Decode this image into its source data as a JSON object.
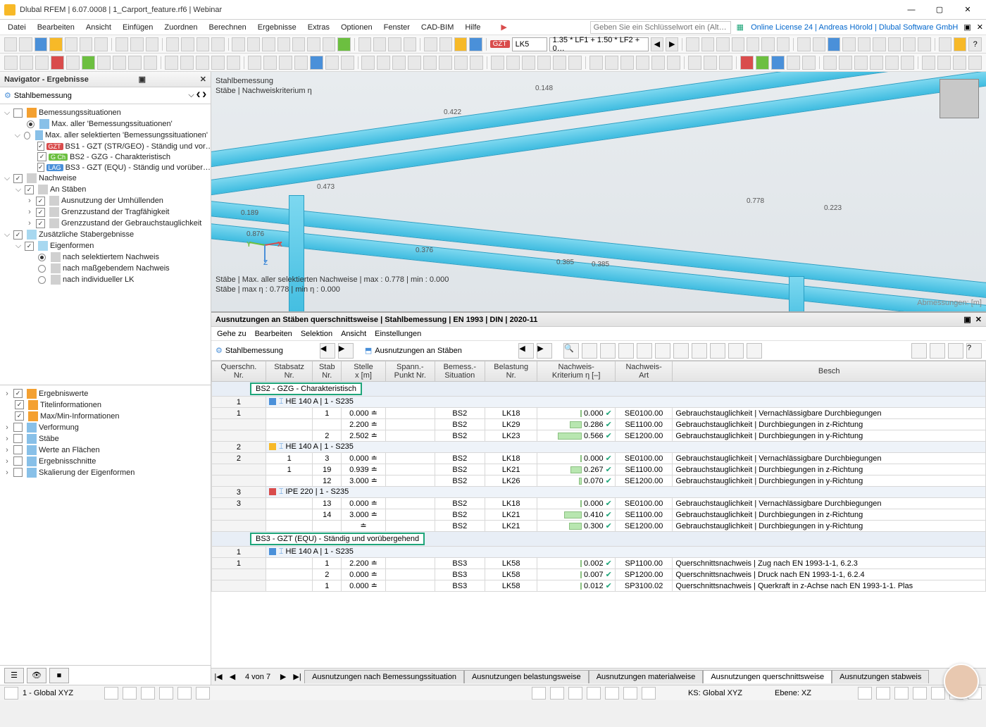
{
  "title": "Dlubal RFEM | 6.07.0008 | 1_Carport_feature.rf6 | Webinar",
  "menu": [
    "Datei",
    "Bearbeiten",
    "Ansicht",
    "Einfügen",
    "Zuordnen",
    "Berechnen",
    "Ergebnisse",
    "Extras",
    "Optionen",
    "Fenster",
    "CAD-BIM",
    "Hilfe"
  ],
  "search_placeholder": "Geben Sie ein Schlüsselwort ein (Alt…",
  "license": "Online License 24 | Andreas Hörold | Dlubal Software GmbH",
  "lc_badge": "GZT",
  "lc_combo": "LK5",
  "lc_formula": "1.35 * LF1 + 1.50 * LF2 + 0…",
  "nav": {
    "header": "Navigator - Ergebnisse",
    "selector": "Stahlbemessung",
    "tree": {
      "bs": "Bemessungssituationen",
      "bs_max_all": "Max. aller 'Bemessungssituationen'",
      "bs_max_sel": "Max. aller selektierten 'Bemessungssituationen'",
      "bs1": "BS1 - GZT (STR/GEO) - Ständig und vor…",
      "bs2": "BS2 - GZG - Charakteristisch",
      "bs3": "BS3 - GZT (EQU) - Ständig und vorüber…",
      "nachw": "Nachweise",
      "an_st": "An Stäben",
      "aus_umh": "Ausnutzung der Umhüllenden",
      "grenz_trag": "Grenzzustand der Tragfähigkeit",
      "grenz_gebr": "Grenzzustand der Gebrauchstauglichkeit",
      "zus": "Zusätzliche Stabergebnisse",
      "eigen": "Eigenformen",
      "e_sel": "nach selektiertem Nachweis",
      "e_mass": "nach maßgebendem Nachweis",
      "e_ind": "nach individueller LK"
    },
    "bottom": {
      "erg": "Ergebniswerte",
      "titel": "Titelinformationen",
      "maxmin": "Max/Min-Informationen",
      "verf": "Verformung",
      "staebe": "Stäbe",
      "flae": "Werte an Flächen",
      "ergsch": "Ergebnisschnitte",
      "skal": "Skalierung der Eigenformen"
    }
  },
  "viewport": {
    "title1": "Stahlbemessung",
    "title2": "Stäbe | Nachweiskriterium η",
    "status1": "Stäbe | Max. aller selektierten Nachweise | max  : 0.778 | min  : 0.000",
    "status2": "Stäbe | max η : 0.778 | min η : 0.000",
    "dim": "Abmessungen: [m]",
    "values": [
      "0.148",
      "0.422",
      "0.473",
      "0.189",
      "0.876",
      "0.376",
      "0.385",
      "0.385",
      "0.778",
      "0.223"
    ]
  },
  "panel": {
    "title": "Ausnutzungen an Stäben querschnittsweise | Stahlbemessung | EN 1993 | DIN | 2020-11",
    "menu": [
      "Gehe zu",
      "Bearbeiten",
      "Selektion",
      "Ansicht",
      "Einstellungen"
    ],
    "sel1": "Stahlbemessung",
    "sel2": "Ausnutzungen an Stäben",
    "headers": [
      "Querschn.\nNr.",
      "Stabsatz\nNr.",
      "Stab\nNr.",
      "Stelle\nx [m]",
      "Spann.-\nPunkt Nr.",
      "Bemess.-\nSituation",
      "Belastung\nNr.",
      "Nachweis-\nKriterium η [–]",
      "Nachweis-\nArt",
      "Besch"
    ],
    "group1": "BS2 - GZG - Charakteristisch",
    "sec1": "HE 140 A | 1 - S235",
    "rows1": [
      {
        "q": "1",
        "ss": "",
        "st": "1",
        "x": "0.000",
        "bs": "BS2",
        "lk": "LK18",
        "k": "0.000",
        "code": "SE0100.00",
        "desc": "Gebrauchstauglichkeit | Vernachlässigbare Durchbiegungen"
      },
      {
        "q": "",
        "ss": "",
        "st": "",
        "x": "2.200",
        "bs": "BS2",
        "lk": "LK29",
        "k": "0.286",
        "code": "SE1100.00",
        "desc": "Gebrauchstauglichkeit | Durchbiegungen in z-Richtung"
      },
      {
        "q": "",
        "ss": "",
        "st": "2",
        "x": "2.502",
        "bs": "BS2",
        "lk": "LK23",
        "k": "0.566",
        "code": "SE1200.00",
        "desc": "Gebrauchstauglichkeit | Durchbiegungen in y-Richtung"
      }
    ],
    "sec2": "HE 140 A | 1 - S235",
    "rows2": [
      {
        "q": "2",
        "ss": "1",
        "st": "3",
        "x": "0.000",
        "bs": "BS2",
        "lk": "LK18",
        "k": "0.000",
        "code": "SE0100.00",
        "desc": "Gebrauchstauglichkeit | Vernachlässigbare Durchbiegungen"
      },
      {
        "q": "",
        "ss": "1",
        "st": "19",
        "x": "0.939",
        "bs": "BS2",
        "lk": "LK21",
        "k": "0.267",
        "code": "SE1100.00",
        "desc": "Gebrauchstauglichkeit | Durchbiegungen in z-Richtung"
      },
      {
        "q": "",
        "ss": "",
        "st": "12",
        "x": "3.000",
        "bs": "BS2",
        "lk": "LK26",
        "k": "0.070",
        "code": "SE1200.00",
        "desc": "Gebrauchstauglichkeit | Durchbiegungen in y-Richtung"
      }
    ],
    "sec3": "IPE 220 | 1 - S235",
    "rows3": [
      {
        "q": "3",
        "ss": "",
        "st": "13",
        "x": "0.000",
        "bs": "BS2",
        "lk": "LK18",
        "k": "0.000",
        "code": "SE0100.00",
        "desc": "Gebrauchstauglichkeit | Vernachlässigbare Durchbiegungen"
      },
      {
        "q": "",
        "ss": "",
        "st": "14",
        "x": "3.000",
        "bs": "BS2",
        "lk": "LK21",
        "k": "0.410",
        "code": "SE1100.00",
        "desc": "Gebrauchstauglichkeit | Durchbiegungen in z-Richtung"
      },
      {
        "q": "",
        "ss": "",
        "st": "",
        "x": "",
        "bs": "BS2",
        "lk": "LK21",
        "k": "0.300",
        "code": "SE1200.00",
        "desc": "Gebrauchstauglichkeit | Durchbiegungen in y-Richtung"
      }
    ],
    "group2": "BS3 - GZT (EQU) - Ständig und vorübergehend",
    "sec4": "HE 140 A | 1 - S235",
    "rows4": [
      {
        "q": "1",
        "ss": "",
        "st": "1",
        "x": "2.200",
        "bs": "BS3",
        "lk": "LK58",
        "k": "0.002",
        "code": "SP1100.00",
        "desc": "Querschnittsnachweis | Zug nach EN 1993-1-1, 6.2.3"
      },
      {
        "q": "",
        "ss": "",
        "st": "2",
        "x": "0.000",
        "bs": "BS3",
        "lk": "LK58",
        "k": "0.007",
        "code": "SP1200.00",
        "desc": "Querschnittsnachweis | Druck nach EN 1993-1-1, 6.2.4"
      },
      {
        "q": "",
        "ss": "",
        "st": "1",
        "x": "0.000",
        "bs": "BS3",
        "lk": "LK58",
        "k": "0.012",
        "code": "SP3100.02",
        "desc": "Querschnittsnachweis | Querkraft in z-Achse nach EN 1993-1-1.    Plas"
      }
    ],
    "page": "4 von 7",
    "tabs": [
      "Ausnutzungen nach Bemessungssituation",
      "Ausnutzungen belastungsweise",
      "Ausnutzungen materialweise",
      "Ausnutzungen querschnittsweise",
      "Ausnutzungen stabweis"
    ]
  },
  "status": {
    "cs": "1 - Global XYZ",
    "ks": "KS: Global XYZ",
    "ebene": "Ebene: XZ"
  }
}
